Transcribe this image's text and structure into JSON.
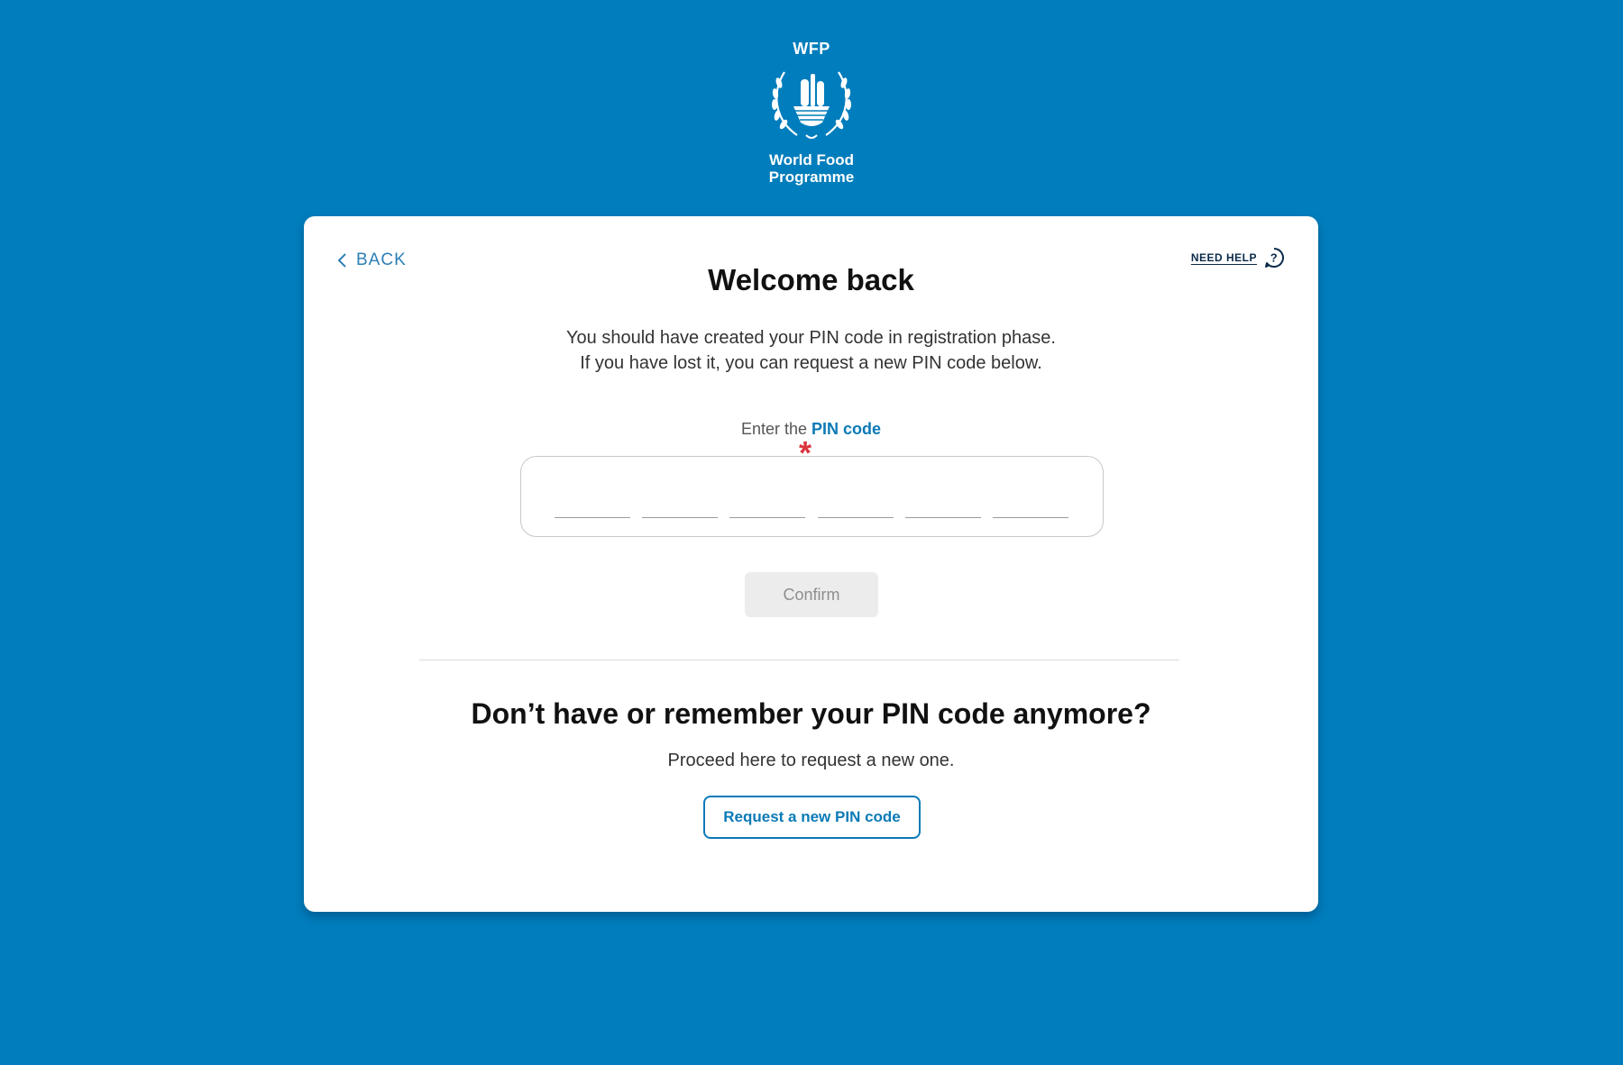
{
  "logo": {
    "acronym": "WFP",
    "name_line1": "World Food",
    "name_line2": "Programme"
  },
  "nav": {
    "back_label": "BACK",
    "help_label": "NEED HELP",
    "help_icon_glyph": "?"
  },
  "login": {
    "title": "Welcome back",
    "description_line1": "You should have created your PIN code in registration phase.",
    "description_line2": "If you have lost it, you can request a new PIN code below.",
    "pin_label_prefix": "Enter the ",
    "pin_label_highlight": "PIN code",
    "required_marker": "*",
    "pin_digits": [
      "",
      "",
      "",
      "",
      "",
      ""
    ],
    "confirm_label": "Confirm"
  },
  "recovery": {
    "title": "Don’t have or remember your PIN code anymore?",
    "subtitle": "Proceed here to request a new one.",
    "request_label": "Request a new PIN code"
  },
  "colors": {
    "background": "#007dbc",
    "accent": "#0b7ab6",
    "required": "#d9363e",
    "disabled_button": "#ececec"
  },
  "icons": [
    "wfp-emblem-icon",
    "chevron-left-icon",
    "question-circle-icon"
  ]
}
